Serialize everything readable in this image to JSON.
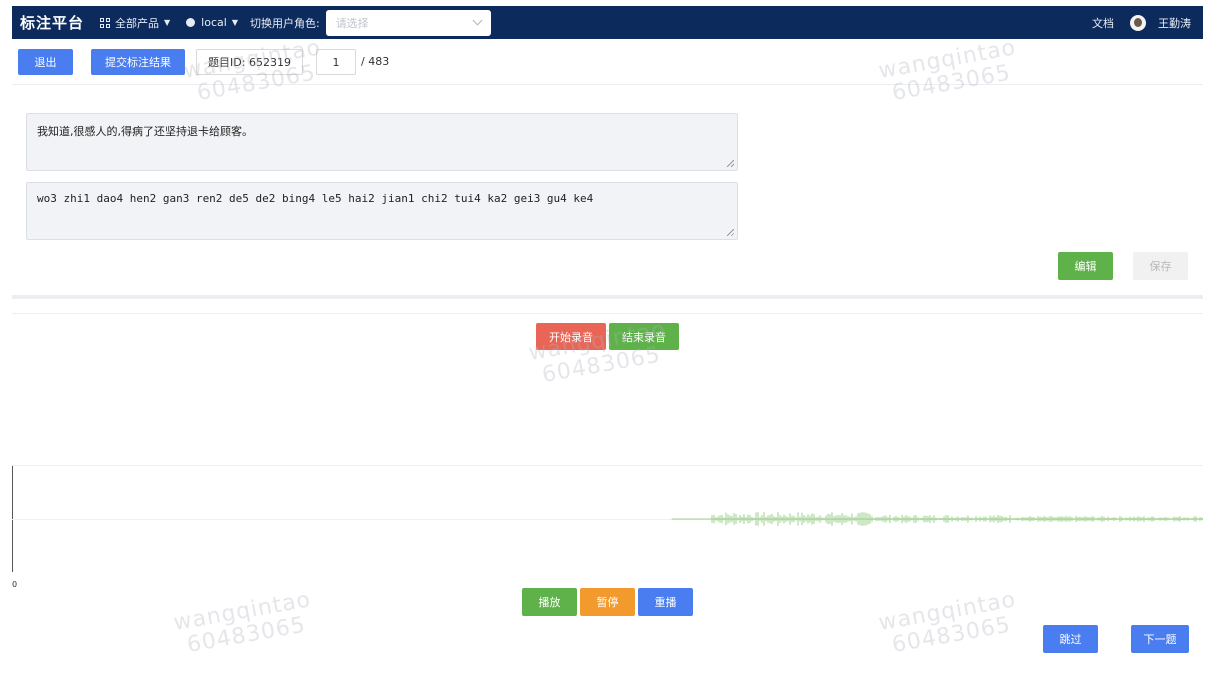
{
  "app": {
    "title": "标注平台",
    "products_label": "全部产品",
    "env_label": "local",
    "role_label": "切换用户角色:",
    "role_placeholder": "请选择",
    "docs_label": "文档",
    "user_name": "王勤涛"
  },
  "toolbar": {
    "exit_label": "退出",
    "submit_label": "提交标注结果",
    "question_id_label": "题目ID: 652319",
    "page_current": "1",
    "page_total": "/ 483"
  },
  "content": {
    "text": "我知道,很感人的,得病了还坚持退卡给顾客。",
    "pinyin": "wo3 zhi1 dao4 hen2 gan3 ren2 de5 de2 bing4 le5 hai2 jian1 chi2 tui4 ka2 gei3 gu4 ke4",
    "edit_label": "编辑",
    "save_label": "保存"
  },
  "recording": {
    "start_label": "开始录音",
    "stop_label": "结束录音"
  },
  "player": {
    "axis_label": "0",
    "play_label": "播放",
    "pause_label": "暂停",
    "replay_label": "重播",
    "waveform_color": "#9ccf8c"
  },
  "footer": {
    "skip_label": "跳过",
    "next_label": "下一题"
  },
  "watermark": {
    "line1": "wangqintao",
    "line2": "60483065"
  },
  "colors": {
    "nav_bg": "#0d2a5c",
    "primary": "#4a7df0",
    "success": "#5fb24a",
    "danger": "#e96656",
    "warning": "#f39a2f"
  }
}
